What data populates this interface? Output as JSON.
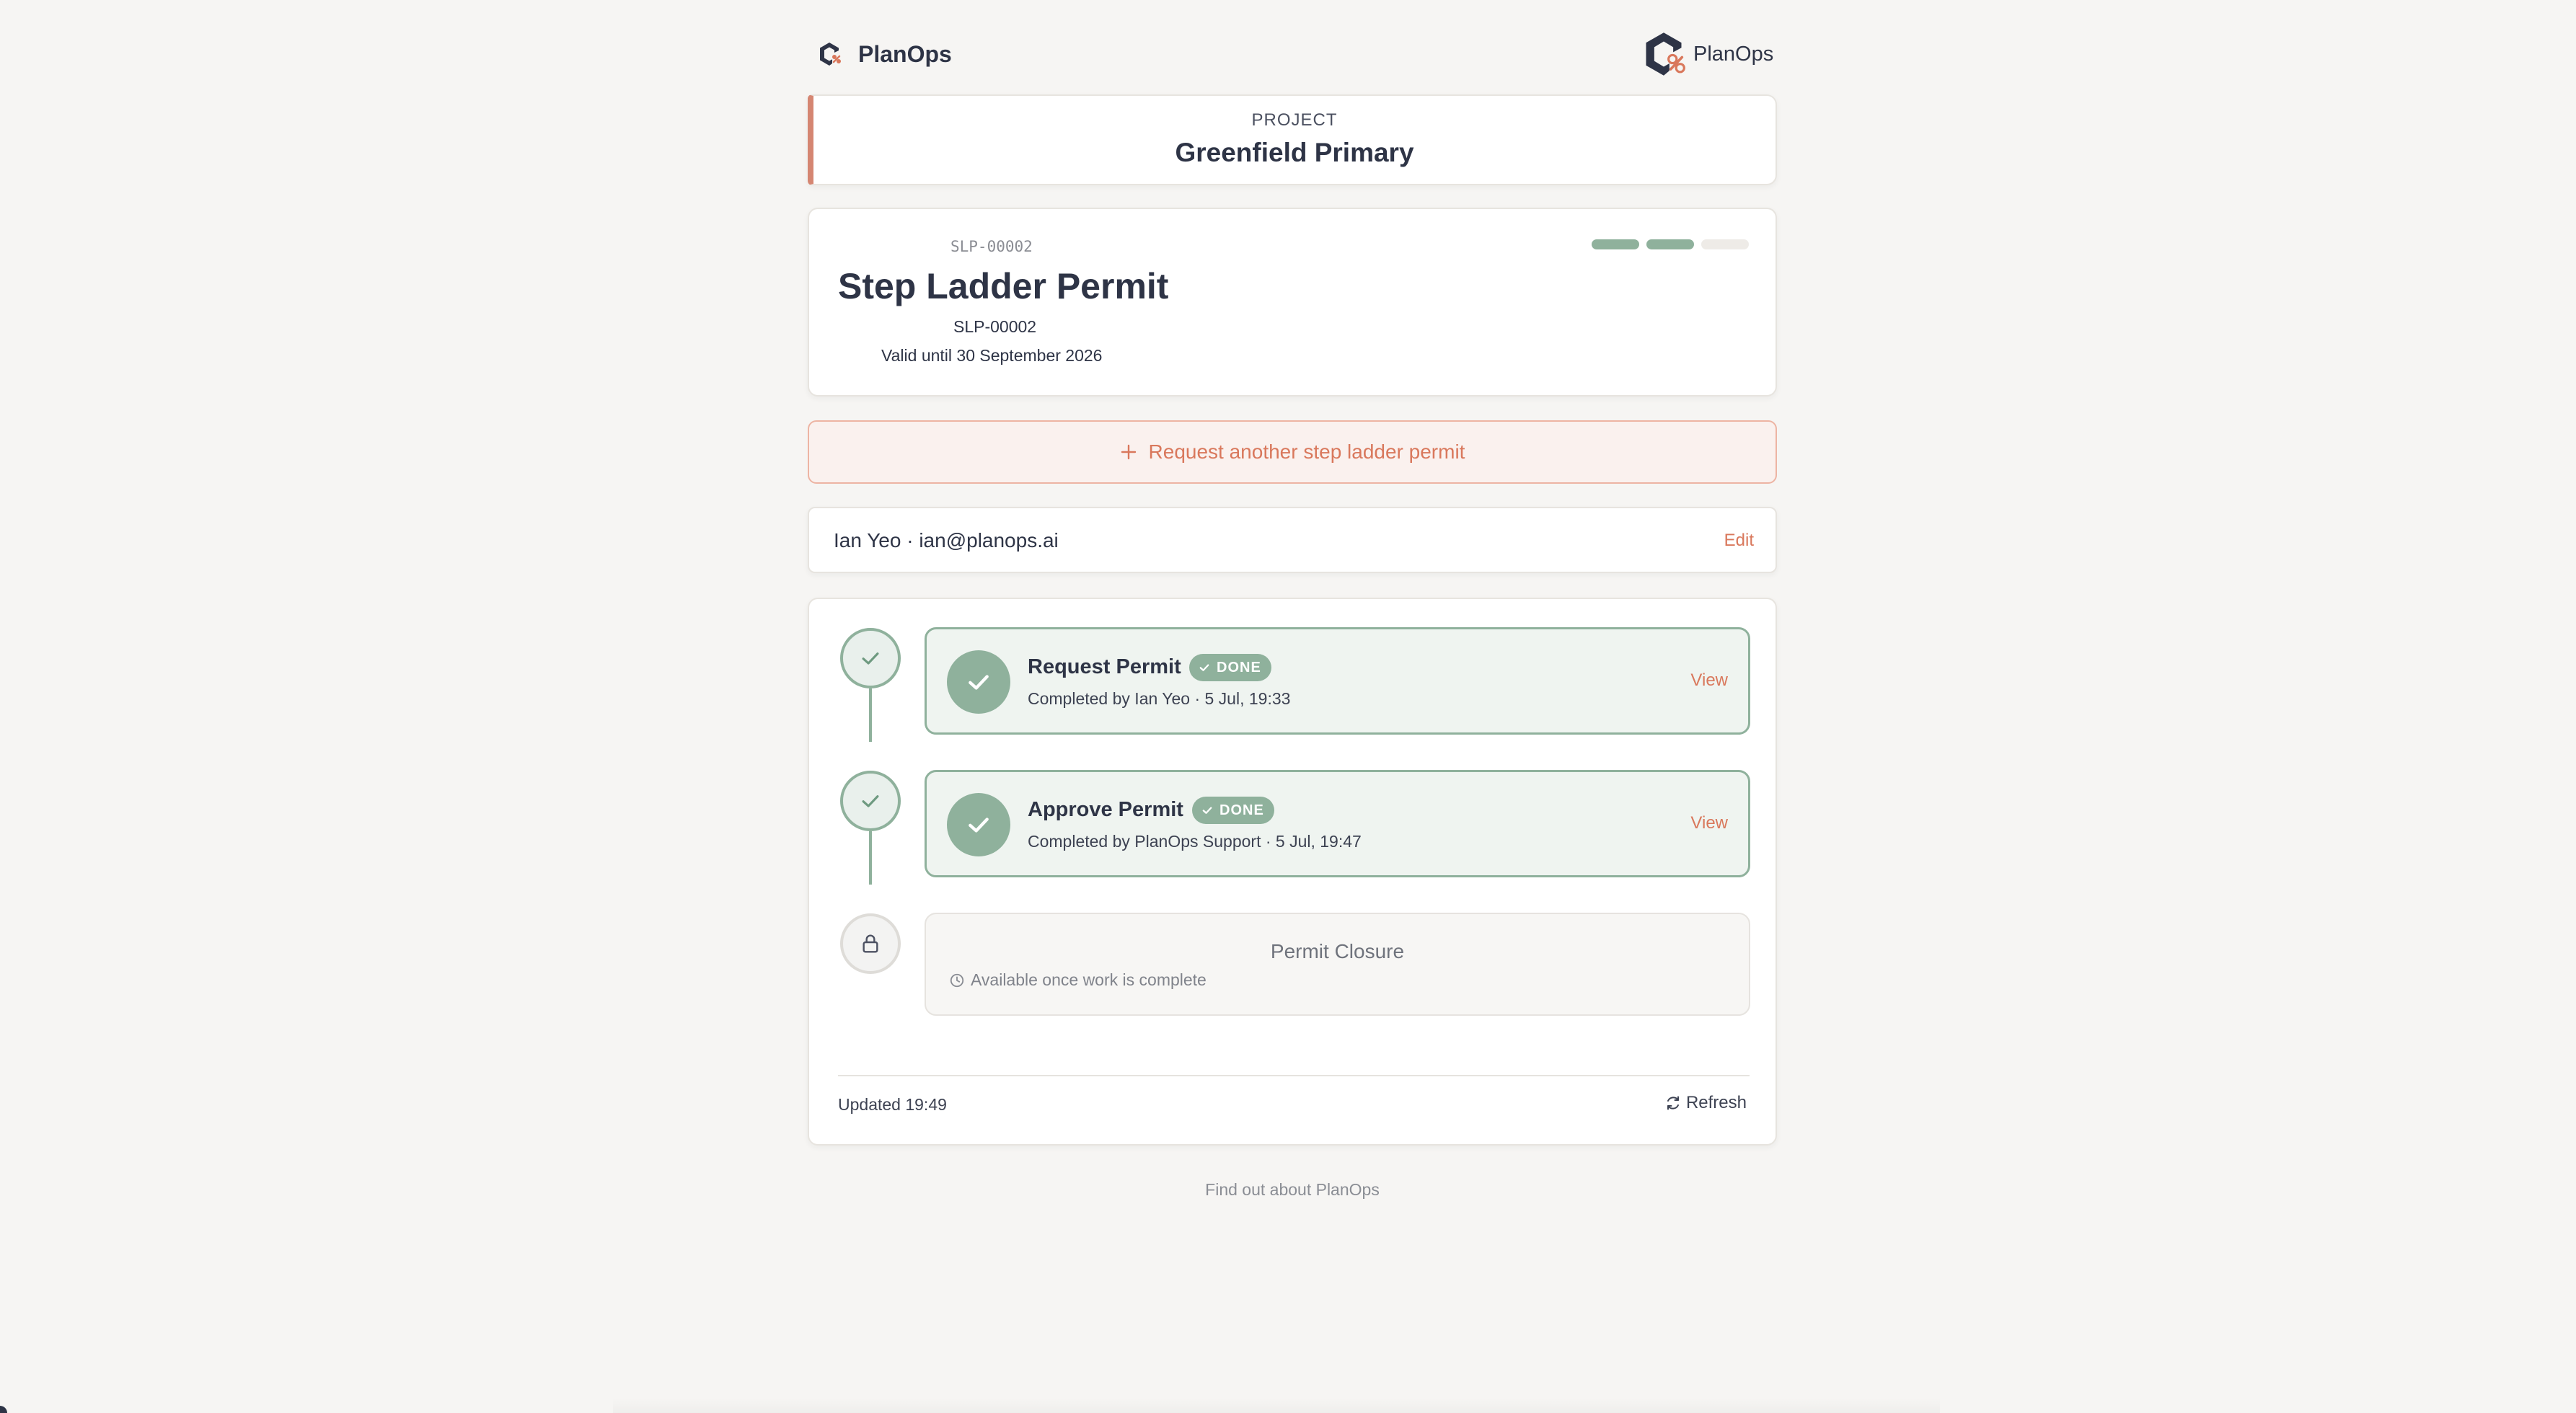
{
  "header": {
    "brand_left": "PlanOps",
    "brand_right": "PlanOps"
  },
  "project": {
    "label": "PROJECT",
    "name": "Greenfield Primary"
  },
  "permit": {
    "code_mono": "SLP-00002",
    "title": "Step Ladder Permit",
    "code": "SLP-00002",
    "validity": "Valid until 30 September 2026",
    "progress_steps_done": 2,
    "progress_steps_total": 3
  },
  "request_another": {
    "label": "Request another step ladder permit"
  },
  "user": {
    "identity": "Ian Yeo · ian@planops.ai",
    "edit_label": "Edit"
  },
  "steps": [
    {
      "title": "Request Permit",
      "badge": "DONE",
      "meta": "Completed by Ian Yeo · 5 Jul, 19:33",
      "action": "View"
    },
    {
      "title": "Approve Permit",
      "badge": "DONE",
      "meta": "Completed by PlanOps Support · 5 Jul, 19:47",
      "action": "View"
    },
    {
      "title": "Permit Closure",
      "meta": "Available once work is complete"
    }
  ],
  "footer": {
    "updated": "Updated 19:49",
    "refresh_label": "Refresh",
    "about_link": "Find out about PlanOps"
  },
  "colors": {
    "accent_orange": "#d9785c",
    "done_green": "#8fb19c",
    "text_dark": "#2e3446",
    "background": "#f6f5f3"
  },
  "icons": {
    "logo": "planops-logo-icon",
    "check": "check-icon",
    "lock": "lock-icon",
    "clock": "clock-icon",
    "plus": "plus-icon",
    "refresh": "refresh-icon"
  }
}
